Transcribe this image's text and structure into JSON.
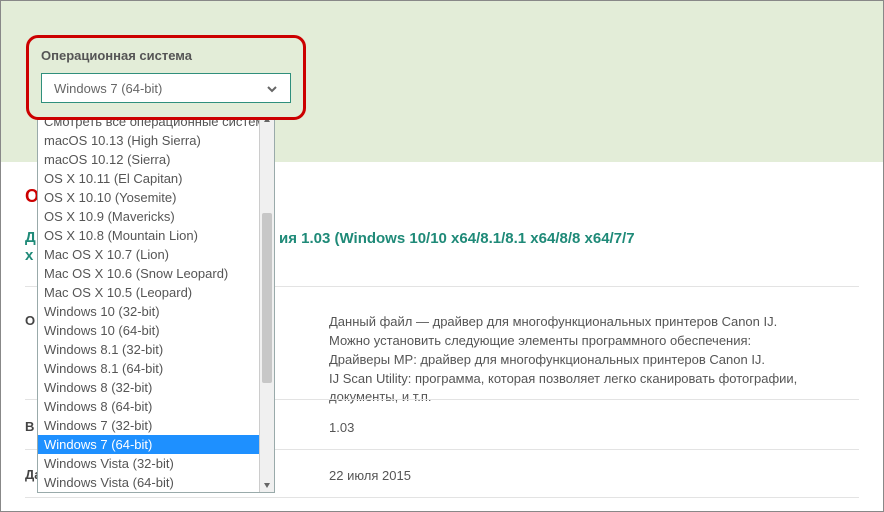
{
  "os_selector": {
    "label": "Операционная система",
    "value": "Windows 7 (64-bit)",
    "options": [
      "Смотреть все операционные системы",
      "macOS 10.13 (High Sierra)",
      "macOS 10.12 (Sierra)",
      "OS X 10.11 (El Capitan)",
      "OS X 10.10 (Yosemite)",
      "OS X 10.9 (Mavericks)",
      "OS X 10.8 (Mountain Lion)",
      "Mac OS X 10.7 (Lion)",
      "Mac OS X 10.6 (Snow Leopard)",
      "Mac OS X 10.5 (Leopard)",
      "Windows 10 (32-bit)",
      "Windows 10 (64-bit)",
      "Windows 8.1 (32-bit)",
      "Windows 8.1 (64-bit)",
      "Windows 8 (32-bit)",
      "Windows 8 (64-bit)",
      "Windows 7 (32-bit)",
      "Windows 7 (64-bit)",
      "Windows Vista (32-bit)",
      "Windows Vista (64-bit)"
    ],
    "selected_index": 17
  },
  "fragments": {
    "o": "О",
    "d": "Д",
    "x": "x"
  },
  "title_suffix": "ия 1.03 (Windows 10/10 x64/8.1/8.1 x64/8/8 x64/7/7",
  "rows": {
    "desc_label": "О",
    "description": "Данный файл — драйвер для многофункциональных принтеров Canon IJ.\nМожно установить следующие элементы программного обеспечения:\nДрайверы MP: драйвер для многофункциональных принтеров Canon IJ.\nIJ Scan Utility: программа, которая позволяет легко сканировать фотографии, документы, и т.п.",
    "version_label": "В",
    "version_value": "1.03",
    "date_label": "Дата выпуска",
    "date_value": "22 июля 2015"
  }
}
